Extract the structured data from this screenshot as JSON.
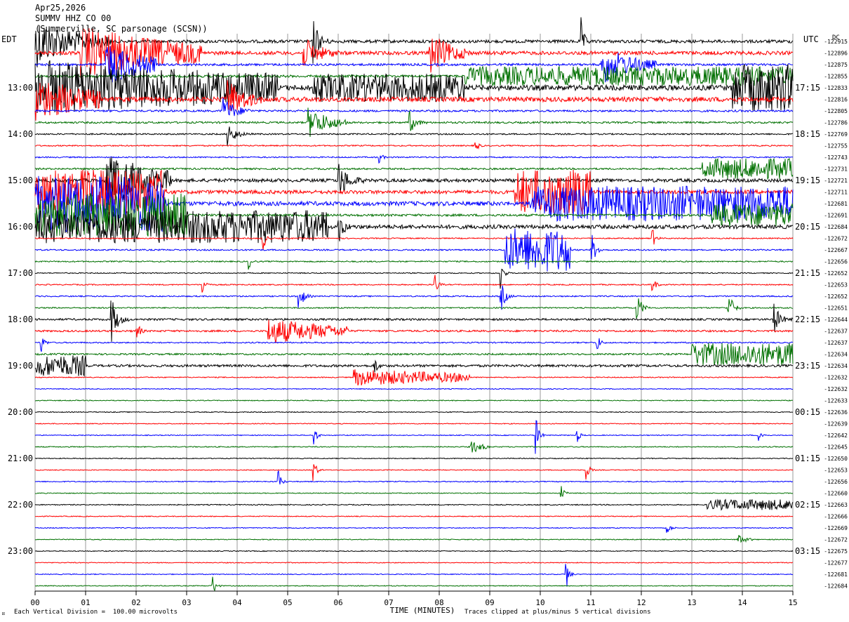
{
  "header": {
    "date": "Apr25,2026",
    "station": "SUMMV HHZ CO 00",
    "location": "(Summerville, SC parsonage (SCSN))",
    "left_tz": "EDT",
    "right_tz": "UTC",
    "dc_label": "DC"
  },
  "footer": {
    "scale_note": "Each Vertical Division =  100.00 microvolts",
    "clip_note": "Traces clipped at plus/minus 5 vertical divisions",
    "corner_mark": "¤"
  },
  "colors": {
    "cycle": [
      "#000000",
      "#ff0000",
      "#0000ff",
      "#007000"
    ],
    "grid": "#999999",
    "background": "#ffffff"
  },
  "chart_data": {
    "type": "helicorder",
    "xlabel": "TIME (MINUTES)",
    "x_ticks": [
      "00",
      "01",
      "02",
      "03",
      "04",
      "05",
      "06",
      "07",
      "08",
      "09",
      "10",
      "11",
      "12",
      "13",
      "14",
      "15"
    ],
    "xlim": [
      0,
      15
    ],
    "minutes_per_line": 15,
    "lines_per_hour": 4,
    "left_hour_labels": [
      "13:00",
      "14:00",
      "15:00",
      "16:00",
      "17:00",
      "18:00",
      "19:00",
      "20:00",
      "21:00",
      "22:00",
      "23:00"
    ],
    "right_hour_labels": [
      "17:15",
      "18:15",
      "19:15",
      "20:15",
      "21:15",
      "22:15",
      "23:15",
      "00:15",
      "01:15",
      "02:15",
      "03:15"
    ],
    "first_labeled_line": 5,
    "dc_offsets": [
      "-122915",
      "-122896",
      "-122875",
      "-122855",
      "-122833",
      "-122816",
      "-122805",
      "-122786",
      "-122769",
      "-122755",
      "-122743",
      "-122731",
      "-122721",
      "-122711",
      "-122681",
      "-122691",
      "-122684",
      "-122672",
      "-122667",
      "-122656",
      "-122652",
      "-122653",
      "-122652",
      "-122651",
      "-122644",
      "-122637",
      "-122637",
      "-122634",
      "-122634",
      "-122632",
      "-122632",
      "-122633",
      "-122636",
      "-122639",
      "-122642",
      "-122645",
      "-122650",
      "-122653",
      "-122656",
      "-122660",
      "-122663",
      "-122666",
      "-122669",
      "-122672",
      "-122675",
      "-122677",
      "-122681",
      "-122684"
    ],
    "trace_noise_levels": [
      2.2,
      2.6,
      1.6,
      1.8,
      3.8,
      3.4,
      1.4,
      1.3,
      1.0,
      0.9,
      0.9,
      1.2,
      2.4,
      2.6,
      3.0,
      1.6,
      2.8,
      0.8,
      1.0,
      0.9,
      0.7,
      0.8,
      0.9,
      0.9,
      1.4,
      1.3,
      0.9,
      1.2,
      1.7,
      0.7,
      0.6,
      0.6,
      0.6,
      0.6,
      0.6,
      0.7,
      0.6,
      0.6,
      0.7,
      0.6,
      0.7,
      0.6,
      0.6,
      0.6,
      0.6,
      0.6,
      0.6,
      0.6
    ],
    "events": [
      {
        "line": 0,
        "start": 0.0,
        "end": 1.5,
        "amp": 5,
        "decay": 0.5
      },
      {
        "line": 0,
        "start": 5.5,
        "end": 5.9,
        "amp": 5,
        "decay": 1
      },
      {
        "line": 0,
        "start": 10.8,
        "end": 11.0,
        "amp": 5,
        "decay": 1
      },
      {
        "line": 1,
        "start": 0.9,
        "end": 3.3,
        "amp": 5,
        "decay": 0.3
      },
      {
        "line": 1,
        "start": 5.3,
        "end": 6.0,
        "amp": 3,
        "decay": 0.6
      },
      {
        "line": 1,
        "start": 7.8,
        "end": 8.6,
        "amp": 4,
        "decay": 0.5
      },
      {
        "line": 2,
        "start": 1.4,
        "end": 2.4,
        "amp": 4,
        "decay": 0.3
      },
      {
        "line": 2,
        "start": 11.2,
        "end": 12.3,
        "amp": 4,
        "decay": 0.5
      },
      {
        "line": 3,
        "start": 8.5,
        "end": 15.0,
        "amp": 1.6,
        "decay": 0
      },
      {
        "line": 4,
        "start": 0.0,
        "end": 4.8,
        "amp": 5,
        "decay": 0.2
      },
      {
        "line": 4,
        "start": 5.5,
        "end": 8.5,
        "amp": 2.2,
        "decay": 0
      },
      {
        "line": 4,
        "start": 13.8,
        "end": 15.0,
        "amp": 4,
        "decay": 0
      },
      {
        "line": 5,
        "start": 0.0,
        "end": 1.3,
        "amp": 4,
        "decay": 0.3
      },
      {
        "line": 5,
        "start": 3.8,
        "end": 4.5,
        "amp": 4,
        "decay": 0.6
      },
      {
        "line": 6,
        "start": 3.7,
        "end": 4.3,
        "amp": 3,
        "decay": 0.7
      },
      {
        "line": 7,
        "start": 5.4,
        "end": 6.2,
        "amp": 3,
        "decay": 0.5
      },
      {
        "line": 7,
        "start": 7.4,
        "end": 7.8,
        "amp": 2.5,
        "decay": 1
      },
      {
        "line": 8,
        "start": 3.8,
        "end": 4.3,
        "amp": 3,
        "decay": 1
      },
      {
        "line": 9,
        "start": 8.7,
        "end": 8.9,
        "amp": 1.8,
        "decay": 1
      },
      {
        "line": 10,
        "start": 6.8,
        "end": 7.0,
        "amp": 1.5,
        "decay": 1
      },
      {
        "line": 11,
        "start": 13.2,
        "end": 15.0,
        "amp": 1.8,
        "decay": 0
      },
      {
        "line": 12,
        "start": 1.4,
        "end": 2.7,
        "amp": 5,
        "decay": 0.3
      },
      {
        "line": 12,
        "start": 6.0,
        "end": 6.5,
        "amp": 4,
        "decay": 0.8
      },
      {
        "line": 13,
        "start": 0.0,
        "end": 2.6,
        "amp": 4,
        "decay": 0
      },
      {
        "line": 13,
        "start": 9.5,
        "end": 11.0,
        "amp": 4,
        "decay": 0
      },
      {
        "line": 14,
        "start": 0.0,
        "end": 2.6,
        "amp": 5,
        "decay": 0
      },
      {
        "line": 14,
        "start": 9.8,
        "end": 15.0,
        "amp": 3,
        "decay": 0
      },
      {
        "line": 15,
        "start": 0.0,
        "end": 3.0,
        "amp": 4,
        "decay": 0
      },
      {
        "line": 15,
        "start": 13.4,
        "end": 15.0,
        "amp": 2,
        "decay": 0
      },
      {
        "line": 16,
        "start": 0.0,
        "end": 5.8,
        "amp": 2.8,
        "decay": 0
      },
      {
        "line": 16,
        "start": 6.0,
        "end": 6.3,
        "amp": 4,
        "decay": 1
      },
      {
        "line": 17,
        "start": 4.5,
        "end": 4.7,
        "amp": 3,
        "decay": 1
      },
      {
        "line": 17,
        "start": 12.2,
        "end": 12.4,
        "amp": 3,
        "decay": 1
      },
      {
        "line": 18,
        "start": 9.3,
        "end": 10.6,
        "amp": 4,
        "decay": 0
      },
      {
        "line": 18,
        "start": 11.0,
        "end": 11.3,
        "amp": 4,
        "decay": 1
      },
      {
        "line": 19,
        "start": 4.2,
        "end": 4.4,
        "amp": 2.5,
        "decay": 1
      },
      {
        "line": 20,
        "start": 9.2,
        "end": 9.4,
        "amp": 4,
        "decay": 1
      },
      {
        "line": 21,
        "start": 3.3,
        "end": 3.5,
        "amp": 2.5,
        "decay": 1
      },
      {
        "line": 21,
        "start": 7.9,
        "end": 8.1,
        "amp": 3,
        "decay": 1
      },
      {
        "line": 21,
        "start": 12.2,
        "end": 12.4,
        "amp": 3,
        "decay": 1
      },
      {
        "line": 22,
        "start": 5.2,
        "end": 5.5,
        "amp": 4,
        "decay": 1
      },
      {
        "line": 22,
        "start": 9.2,
        "end": 9.5,
        "amp": 4,
        "decay": 1
      },
      {
        "line": 23,
        "start": 11.9,
        "end": 12.2,
        "amp": 4,
        "decay": 1
      },
      {
        "line": 23,
        "start": 13.7,
        "end": 14.0,
        "amp": 5,
        "decay": 1
      },
      {
        "line": 24,
        "start": 1.5,
        "end": 1.9,
        "amp": 5,
        "decay": 1
      },
      {
        "line": 24,
        "start": 14.6,
        "end": 15.0,
        "amp": 4,
        "decay": 1
      },
      {
        "line": 25,
        "start": 4.6,
        "end": 6.2,
        "amp": 2.5,
        "decay": 0.3
      },
      {
        "line": 25,
        "start": 2.0,
        "end": 2.2,
        "amp": 3,
        "decay": 1
      },
      {
        "line": 26,
        "start": 0.1,
        "end": 0.3,
        "amp": 3,
        "decay": 1
      },
      {
        "line": 26,
        "start": 11.1,
        "end": 11.3,
        "amp": 3,
        "decay": 1
      },
      {
        "line": 27,
        "start": 13.0,
        "end": 15.0,
        "amp": 2,
        "decay": 0
      },
      {
        "line": 28,
        "start": 0.0,
        "end": 1.0,
        "amp": 1.8,
        "decay": 0
      },
      {
        "line": 28,
        "start": 6.7,
        "end": 6.9,
        "amp": 3,
        "decay": 1
      },
      {
        "line": 29,
        "start": 6.3,
        "end": 8.6,
        "amp": 1.6,
        "decay": 0.2
      },
      {
        "line": 34,
        "start": 5.5,
        "end": 5.7,
        "amp": 3,
        "decay": 1
      },
      {
        "line": 34,
        "start": 9.9,
        "end": 10.1,
        "amp": 5,
        "decay": 1
      },
      {
        "line": 34,
        "start": 10.7,
        "end": 10.9,
        "amp": 2.5,
        "decay": 1
      },
      {
        "line": 34,
        "start": 14.3,
        "end": 14.5,
        "amp": 3,
        "decay": 1
      },
      {
        "line": 35,
        "start": 8.6,
        "end": 9.0,
        "amp": 1.5,
        "decay": 0.5
      },
      {
        "line": 37,
        "start": 5.5,
        "end": 5.7,
        "amp": 3,
        "decay": 1
      },
      {
        "line": 37,
        "start": 10.9,
        "end": 11.1,
        "amp": 2.5,
        "decay": 1
      },
      {
        "line": 38,
        "start": 4.8,
        "end": 5.0,
        "amp": 3,
        "decay": 1
      },
      {
        "line": 39,
        "start": 10.4,
        "end": 10.6,
        "amp": 2,
        "decay": 1
      },
      {
        "line": 40,
        "start": 13.3,
        "end": 15.0,
        "amp": 0.9,
        "decay": 0
      },
      {
        "line": 42,
        "start": 12.5,
        "end": 12.7,
        "amp": 2,
        "decay": 1
      },
      {
        "line": 43,
        "start": 13.9,
        "end": 14.2,
        "amp": 1,
        "decay": 0.5
      },
      {
        "line": 46,
        "start": 10.5,
        "end": 10.7,
        "amp": 4,
        "decay": 1
      },
      {
        "line": 47,
        "start": 3.5,
        "end": 3.7,
        "amp": 3,
        "decay": 1
      }
    ]
  }
}
